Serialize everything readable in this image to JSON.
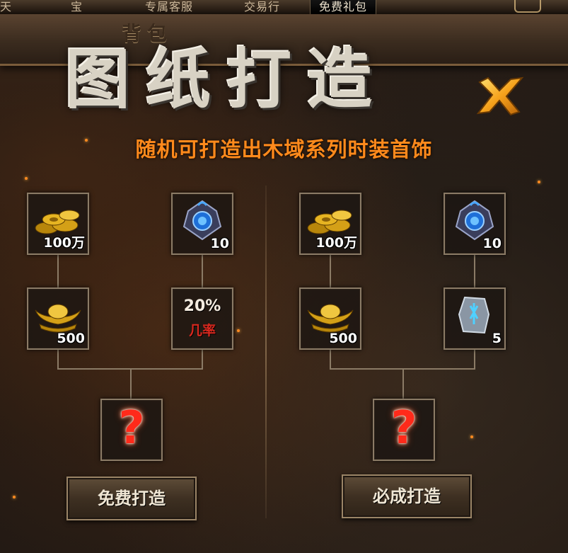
{
  "topbar": {
    "items": [
      "天",
      "宝",
      "专属客服",
      "交易行",
      "免费礼包"
    ]
  },
  "window": {
    "tab_label": "背包",
    "title": "图纸打造",
    "subtitle": "随机可打造出木域系列时装首饰"
  },
  "left_recipe": {
    "gold_count": "100万",
    "crystal_count": "10",
    "ingot_count": "500",
    "rate_value": "20%",
    "rate_label": "几率",
    "result_symbol": "?",
    "button_label": "免费打造"
  },
  "right_recipe": {
    "gold_count": "100万",
    "crystal_count": "10",
    "ingot_count": "500",
    "rune_count": "5",
    "result_symbol": "?",
    "button_label": "必成打造"
  },
  "icons": {
    "close": "close-x-icon",
    "gold": "gold-coins-icon",
    "crystal": "blue-crystal-icon",
    "ingot": "gold-ingot-icon",
    "rune": "rune-stone-icon",
    "unknown": "question-mark-icon"
  },
  "colors": {
    "subtitle": "#ff8a1c",
    "rate_label": "#d8281e",
    "question_mark": "#ff2a1a",
    "slot_border": "#8b7b66"
  }
}
